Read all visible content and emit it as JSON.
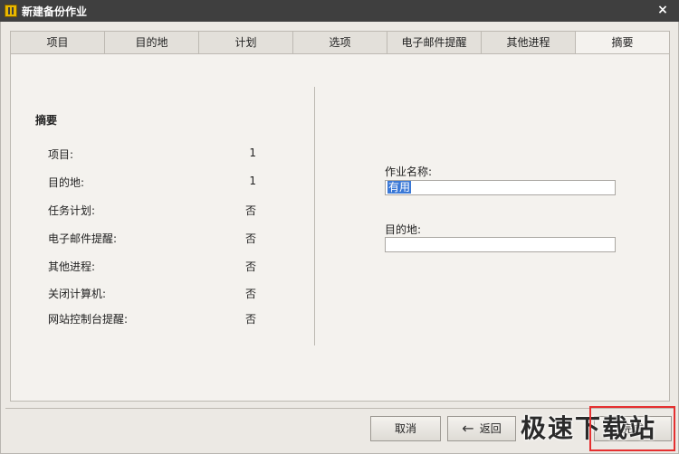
{
  "window": {
    "title": "新建备份作业",
    "close_label": "×"
  },
  "tabs": [
    {
      "label": "项目"
    },
    {
      "label": "目的地"
    },
    {
      "label": "计划"
    },
    {
      "label": "选项"
    },
    {
      "label": "电子邮件提醒"
    },
    {
      "label": "其他进程"
    },
    {
      "label": "摘要",
      "active": true
    }
  ],
  "summary": {
    "heading": "摘要",
    "rows": [
      {
        "label": "项目:",
        "value": "1"
      },
      {
        "label": "目的地:",
        "value": "1"
      },
      {
        "label": "任务计划:",
        "value": "否"
      },
      {
        "label": "电子邮件提醒:",
        "value": "否"
      },
      {
        "label": "其他进程:",
        "value": "否"
      },
      {
        "label": "关闭计算机:",
        "value": "否"
      },
      {
        "label": "网站控制台提醒:",
        "value": "否"
      }
    ]
  },
  "form": {
    "job_name_label": "作业名称:",
    "job_name_value": "有用",
    "destination_label": "目的地:",
    "destination_value": ""
  },
  "buttons": {
    "cancel": "取消",
    "back": "返回",
    "next": "完成"
  },
  "watermark": "极速下载站"
}
